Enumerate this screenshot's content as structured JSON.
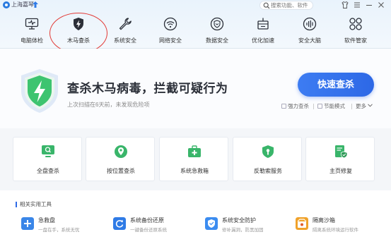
{
  "app": {
    "name": "上海嘉琴"
  },
  "search": {
    "placeholder": "搜索功能、软件"
  },
  "nav": [
    {
      "label": "电脑体检",
      "icon": "monitor-icon"
    },
    {
      "label": "木马查杀",
      "icon": "shield-bolt-icon",
      "active": true
    },
    {
      "label": "系统安全",
      "icon": "wrench-icon"
    },
    {
      "label": "网络安全",
      "icon": "wifi-icon"
    },
    {
      "label": "数据安全",
      "icon": "data-shield-icon"
    },
    {
      "label": "优化加速",
      "icon": "rocket-icon"
    },
    {
      "label": "安全大脑",
      "icon": "brain-icon"
    },
    {
      "label": "软件管家",
      "icon": "apps-icon"
    }
  ],
  "hero": {
    "title": "查杀木马病毒，拦截可疑行为",
    "subtitle": "上次扫描在6天前，未发现危险项",
    "button": "快速查杀",
    "options": {
      "powerful": "强力查杀",
      "eco": "节能模式",
      "more": "更多"
    }
  },
  "cards": [
    {
      "label": "全盘查杀",
      "icon": "full-scan-icon"
    },
    {
      "label": "按位置查杀",
      "icon": "location-scan-icon"
    },
    {
      "label": "系统急救箱",
      "icon": "first-aid-icon"
    },
    {
      "label": "反勒索服务",
      "icon": "anti-ransom-icon"
    },
    {
      "label": "主页修复",
      "icon": "homepage-repair-icon"
    }
  ],
  "tools": {
    "title": "相关实用工具",
    "items": [
      {
        "name": "急救盘",
        "desc": "一盘在手，系统无忧",
        "icon": "rescue-disk-icon",
        "color": "#3a86e8"
      },
      {
        "name": "系统备份还原",
        "desc": "一键备份还原系统",
        "icon": "backup-restore-icon",
        "color": "#2f7be6"
      },
      {
        "name": "系统安全防护",
        "desc": "修补漏洞，防黑加固",
        "icon": "security-guard-icon",
        "color": "#3b8cf0"
      },
      {
        "name": "隔离沙箱",
        "desc": "隔离系统环境运行软件",
        "icon": "sandbox-icon",
        "color": "#f0a22a"
      }
    ]
  },
  "colors": {
    "accent": "#2d68e6",
    "highlight_ring": "#e23a36",
    "shield_green": "#39c46a"
  }
}
